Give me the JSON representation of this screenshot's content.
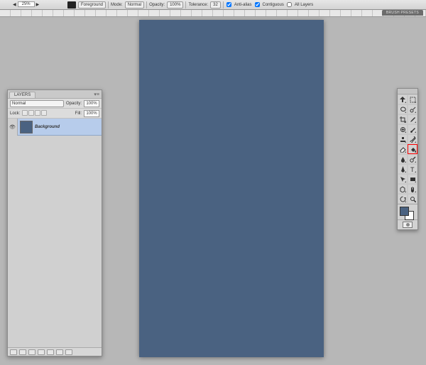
{
  "zoom": {
    "value": "25%"
  },
  "options_bar": {
    "fill_source": "Foreground",
    "mode_label": "Mode:",
    "mode": "Normal",
    "opacity_label": "Opacity:",
    "opacity": "100%",
    "tolerance_label": "Tolerance:",
    "tolerance": "32",
    "anti_alias_label": "Anti-alias",
    "anti_alias": true,
    "contiguous_label": "Contiguous",
    "contiguous": true,
    "all_layers_label": "All Layers",
    "all_layers": false
  },
  "brush_presets_tab": "BRUSH PRESETS",
  "canvas": {
    "fill_color": "#4a6281"
  },
  "layers_panel": {
    "title": "LAYERS",
    "blend_mode": "Normal",
    "opacity_label": "Opacity:",
    "opacity": "100%",
    "lock_label": "Lock:",
    "fill_label": "Fill:",
    "fill": "100%",
    "items": [
      {
        "name": "Background",
        "visible": true
      }
    ]
  },
  "toolbox": {
    "tools": [
      {
        "id": "move",
        "name": "move-tool"
      },
      {
        "id": "marquee",
        "name": "marquee-tool"
      },
      {
        "id": "lasso",
        "name": "lasso-tool"
      },
      {
        "id": "quickselect",
        "name": "quick-select-tool"
      },
      {
        "id": "crop",
        "name": "crop-tool"
      },
      {
        "id": "eyedropper",
        "name": "eyedropper-tool"
      },
      {
        "id": "healing",
        "name": "healing-brush-tool"
      },
      {
        "id": "brush",
        "name": "brush-tool"
      },
      {
        "id": "stamp",
        "name": "clone-stamp-tool"
      },
      {
        "id": "history",
        "name": "history-brush-tool"
      },
      {
        "id": "eraser",
        "name": "eraser-tool"
      },
      {
        "id": "bucket",
        "name": "paint-bucket-tool",
        "selected": true
      },
      {
        "id": "blur",
        "name": "blur-tool"
      },
      {
        "id": "dodge",
        "name": "dodge-tool"
      },
      {
        "id": "pen",
        "name": "pen-tool"
      },
      {
        "id": "type",
        "name": "type-tool"
      },
      {
        "id": "path",
        "name": "path-select-tool"
      },
      {
        "id": "shape",
        "name": "shape-tool"
      },
      {
        "id": "3d",
        "name": "3d-tool"
      },
      {
        "id": "hand",
        "name": "hand-tool"
      },
      {
        "id": "rotate",
        "name": "rotate-view-tool"
      },
      {
        "id": "zoom",
        "name": "zoom-tool"
      }
    ],
    "fg_color": "#4a6281",
    "bg_color": "#ffffff"
  }
}
